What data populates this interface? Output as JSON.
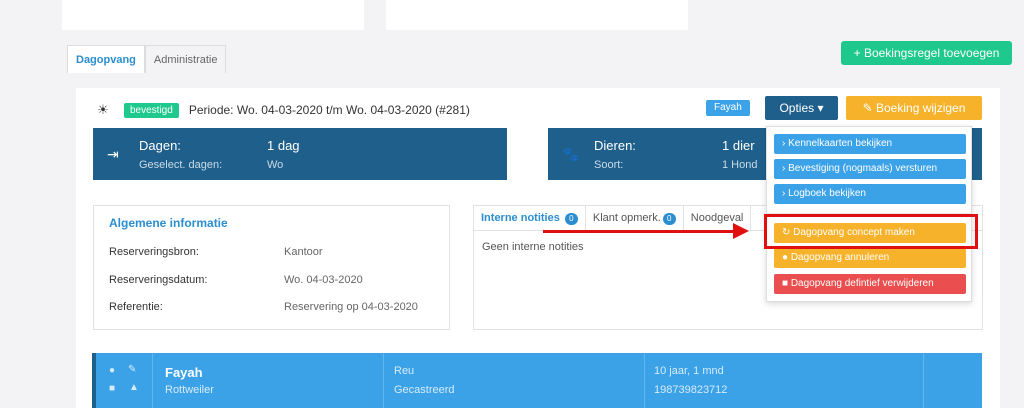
{
  "tabs": [
    "Dagopvang",
    "Administratie"
  ],
  "add_button": "+ Boekingsregel toevoegen",
  "header": {
    "status": "bevestigd",
    "period": "Periode: Wo. 04-03-2020 t/m Wo. 04-03-2020  (#281)",
    "animal_tag": "Fayah",
    "options_label": "Opties ▾",
    "edit_label": "✎ Boeking wijzigen"
  },
  "days_box": {
    "label": "Dagen:",
    "value": "1 dag",
    "sublabel": "Geselect. dagen:",
    "subvalue": "Wo"
  },
  "animals_box": {
    "label": "Dieren:",
    "value": "1 dier",
    "sublabel": "Soort:",
    "subvalue": "1 Hond"
  },
  "info": {
    "title": "Algemene informatie",
    "rows": [
      {
        "label": "Reserveringsbron:",
        "value": "Kantoor"
      },
      {
        "label": "Reserveringsdatum:",
        "value": "Wo. 04-03-2020"
      },
      {
        "label": "Referentie:",
        "value": "Reservering op 04-03-2020"
      }
    ]
  },
  "notes": {
    "tabs": [
      {
        "label": "Interne notities",
        "count": "0"
      },
      {
        "label": "Klant opmerk.",
        "count": "0"
      },
      {
        "label": "Noodgeval",
        "count": ""
      }
    ],
    "empty": "Geen interne notities"
  },
  "menu": {
    "items": [
      {
        "label": "›  Kennelkaarten bekijken"
      },
      {
        "label": "›  Bevestiging (nogmaals) versturen"
      },
      {
        "label": "›  Logboek bekijken"
      },
      {
        "label": "↻  Dagopvang concept maken"
      },
      {
        "label": "●  Dagopvang annuleren"
      },
      {
        "label": "■  Dagopvang defintief verwijderen"
      }
    ]
  },
  "animal": {
    "name": "Fayah",
    "breed": "Rottweiler",
    "sex": "Reu",
    "status": "Gecastreerd",
    "age": "10 jaar, 1 mnd",
    "chip": "198739823712"
  },
  "colors": {
    "accent_blue": "#3ba2e8",
    "dark_blue": "#1f5f8b",
    "green": "#1fc98e",
    "orange": "#f6b22a",
    "red": "#ea4e4e",
    "annotation_red": "#e01010"
  }
}
